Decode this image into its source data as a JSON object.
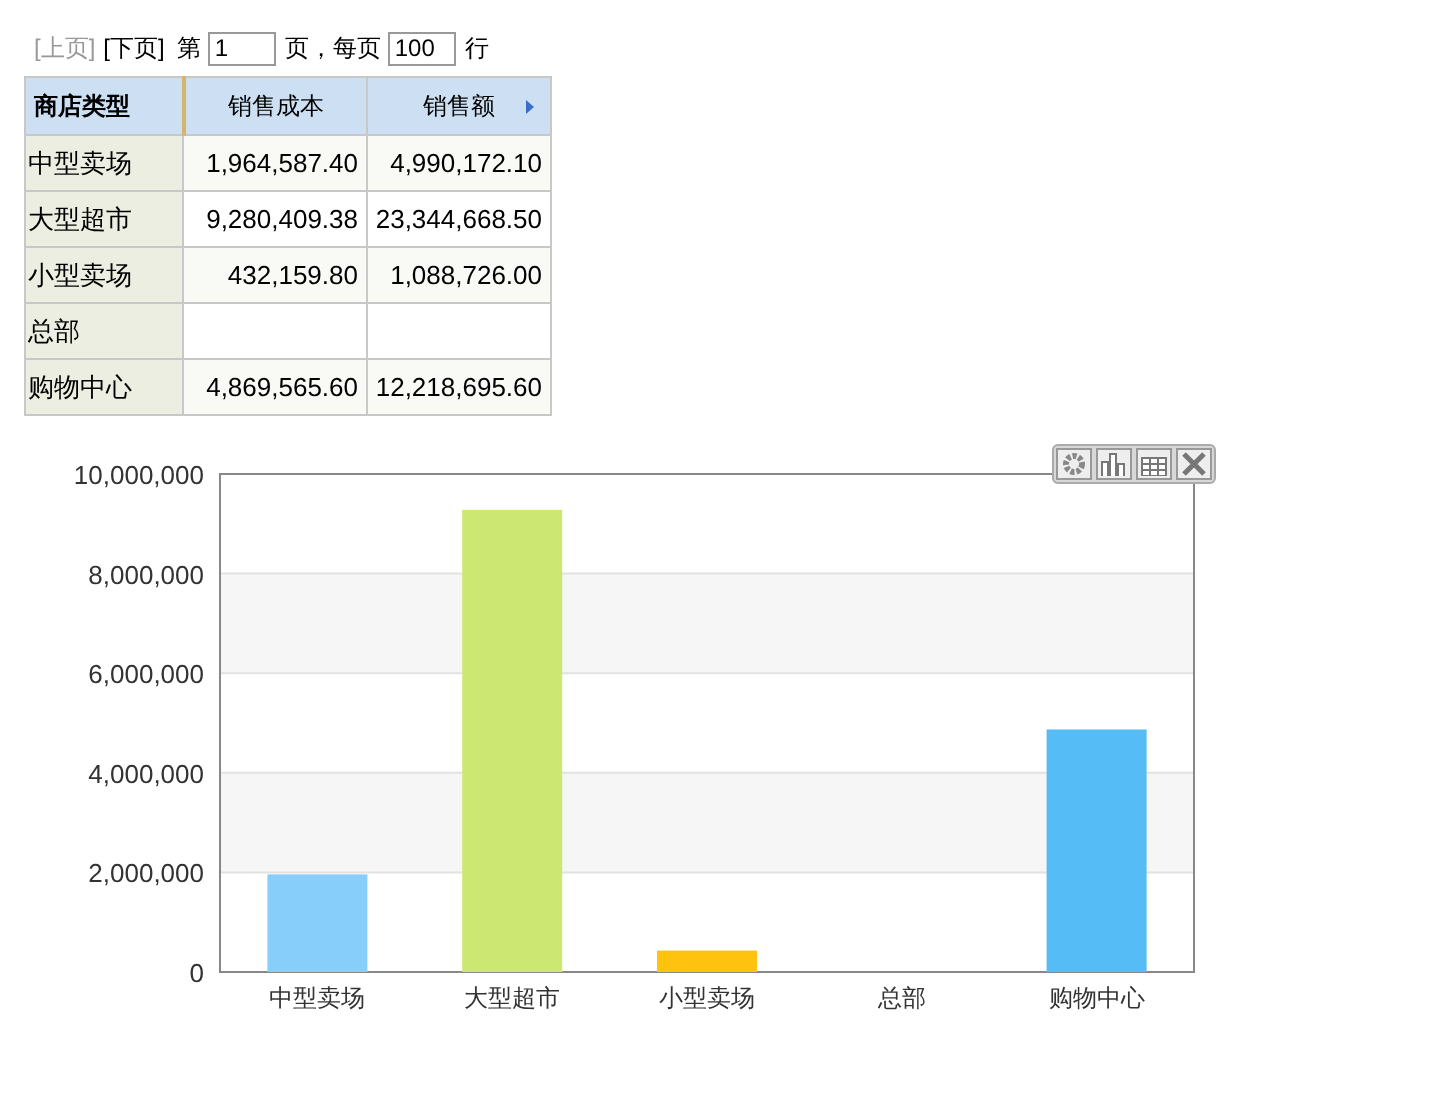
{
  "pager": {
    "prev": {
      "label": "[上页]",
      "disabled": true
    },
    "next": {
      "label": "[下页]",
      "disabled": false
    },
    "page_prefix": "第",
    "page_value": "1",
    "page_suffix": "页，每页",
    "rows_value": "100",
    "rows_suffix": "行"
  },
  "table": {
    "columns": [
      "商店类型",
      "销售成本",
      "销售额"
    ],
    "rows": [
      [
        "中型卖场",
        "1,964,587.40",
        "4,990,172.10"
      ],
      [
        "大型超市",
        "9,280,409.38",
        "23,344,668.50"
      ],
      [
        "小型卖场",
        "432,159.80",
        "1,088,726.00"
      ],
      [
        "总部",
        "",
        ""
      ],
      [
        "购物中心",
        "4,869,565.60",
        "12,218,695.60"
      ]
    ]
  },
  "chart": {
    "chart_data": {
      "type": "bar",
      "grid": true,
      "stacked": true,
      "categories": [
        "中型卖场",
        "大型超市",
        "小型卖场",
        "总部",
        "购物中心"
      ],
      "series": [
        {
          "color": "#87cefa",
          "values": [
            1960000,
            null,
            null,
            null,
            null
          ]
        },
        {
          "color": "#cce872",
          "values": [
            null,
            9280000,
            null,
            null,
            null
          ]
        },
        {
          "color": "#ffc20e",
          "values": [
            null,
            null,
            430000,
            null,
            null
          ]
        },
        {
          "color": "#56bcf5",
          "values": [
            null,
            null,
            null,
            null,
            4870000
          ]
        }
      ],
      "ylim": [
        0,
        10000000
      ],
      "yticks": [
        {
          "value": 0,
          "label": "0"
        },
        {
          "value": 2000000,
          "label": "2,000,000"
        },
        {
          "value": 4000000,
          "label": "4,000,000"
        },
        {
          "value": 6000000,
          "label": "6,000,000"
        },
        {
          "value": 8000000,
          "label": "8,000,000"
        },
        {
          "value": 10000000,
          "label": "10,000,000"
        }
      ]
    }
  }
}
